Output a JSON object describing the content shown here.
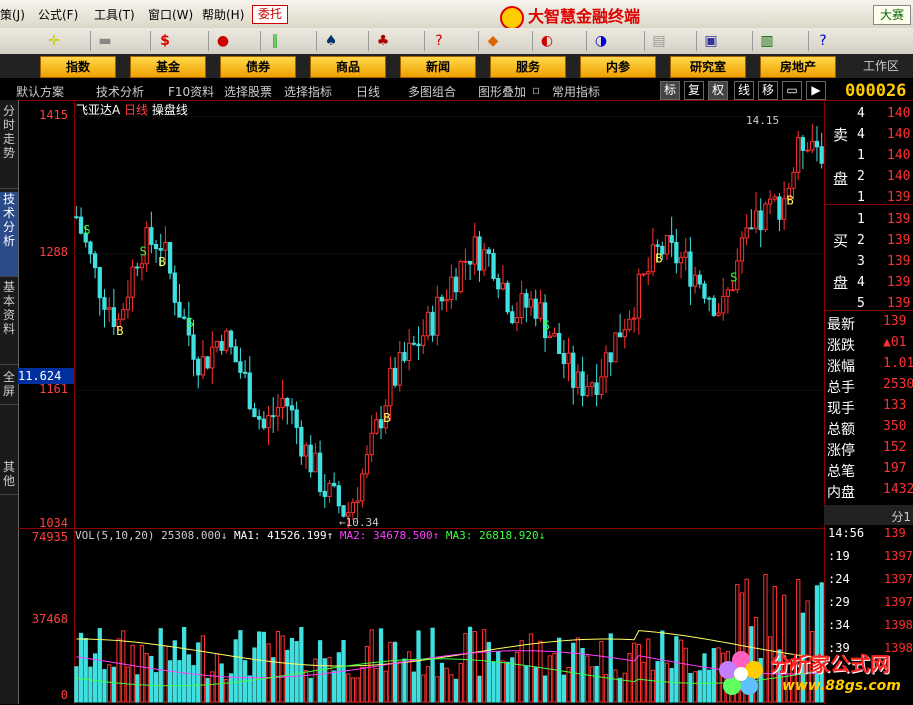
{
  "menu": {
    "items": [
      "策(J)",
      "公式(F)",
      "工具(T)",
      "窗口(W)",
      "帮助(H)"
    ],
    "weituo": "委托",
    "app_title": "大智慧金融终端",
    "dasai": "大赛"
  },
  "nav": {
    "buttons": [
      "指数",
      "基金",
      "债券",
      "商品",
      "新闻",
      "服务",
      "内参",
      "研究室",
      "房地产"
    ],
    "workarea": "工作区"
  },
  "subbar": {
    "items": [
      "默认方案",
      "技术分析",
      "F10资料",
      "选择股票",
      "选择指标",
      "日线",
      "多图组合",
      "图形叠加",
      "常用指标"
    ],
    "buttons": [
      "标",
      "复",
      "权",
      "线",
      "移"
    ],
    "stock_code": "000026"
  },
  "left_tabs": [
    "分时走势",
    "技术分析",
    "基本资料",
    "全屏",
    "其他"
  ],
  "price_axis": {
    "ticks": [
      "1415",
      "1288",
      "1161",
      "1034"
    ],
    "current_price": "11.624"
  },
  "chart_header": {
    "name": "飞亚达A",
    "period": "日线",
    "extra": "操盘线"
  },
  "volume_axis": {
    "ticks": [
      "74935",
      "37468",
      "0"
    ]
  },
  "volume_header": {
    "vol": "VOL(5,10,20)  25308.000↓",
    "ma1": "MA1: 41526.199↑",
    "ma2": "MA2: 34678.500↑",
    "ma3": "MA3: 26818.920↓"
  },
  "chart_data": {
    "type": "candlestick",
    "price_range": [
      10.34,
      14.15
    ],
    "high_label": "14.15",
    "low_label": "10.34",
    "signals_buy": "B",
    "signals_sell": "S",
    "volume_range": [
      0,
      74935
    ]
  },
  "orderbook": {
    "sell_label": [
      "卖",
      "盘"
    ],
    "buy_label": [
      "买",
      "盘"
    ],
    "sell": [
      {
        "level": "5",
        "vol": "4",
        "price": "140"
      },
      {
        "level": "4",
        "vol": "4",
        "price": "140"
      },
      {
        "level": "3",
        "vol": "1",
        "price": "140"
      },
      {
        "level": "2",
        "vol": "2",
        "price": "140"
      },
      {
        "level": "1",
        "vol": "1",
        "price": "139"
      }
    ],
    "buy": [
      {
        "level": "1",
        "vol": "1",
        "price": "139"
      },
      {
        "level": "2",
        "vol": "2",
        "price": "139"
      },
      {
        "level": "3",
        "vol": "3",
        "price": "139"
      },
      {
        "level": "4",
        "vol": "4",
        "price": "139"
      },
      {
        "level": "5",
        "vol": "5",
        "price": "139"
      }
    ]
  },
  "stats": [
    {
      "k": "最新",
      "v": "139"
    },
    {
      "k": "涨跌",
      "v": "▲01"
    },
    {
      "k": "涨幅",
      "v": "1.01"
    },
    {
      "k": "总手",
      "v": "2530"
    },
    {
      "k": "现手",
      "v": "133"
    },
    {
      "k": "总额",
      "v": "350"
    },
    {
      "k": "涨停",
      "v": "152"
    },
    {
      "k": "总笔",
      "v": "197"
    },
    {
      "k": "内盘",
      "v": "1432"
    }
  ],
  "trades": {
    "header": "分1",
    "rows": [
      {
        "t": "14:56",
        "p": "139"
      },
      {
        "t": ":19",
        "p": "1397"
      },
      {
        "t": ":24",
        "p": "1397"
      },
      {
        "t": ":29",
        "p": "1397"
      },
      {
        "t": ":34",
        "p": "1398"
      },
      {
        "t": ":39",
        "p": "1398"
      }
    ]
  },
  "watermark": {
    "text": "分析家公式网",
    "url": "www.88gs.com"
  },
  "colors": {
    "up": "#ff3030",
    "down": "#40e0e0",
    "ma1": "#ffffff",
    "ma2": "#ff40ff",
    "ma3": "#40ff40",
    "vol_ma1": "#ffff60"
  }
}
